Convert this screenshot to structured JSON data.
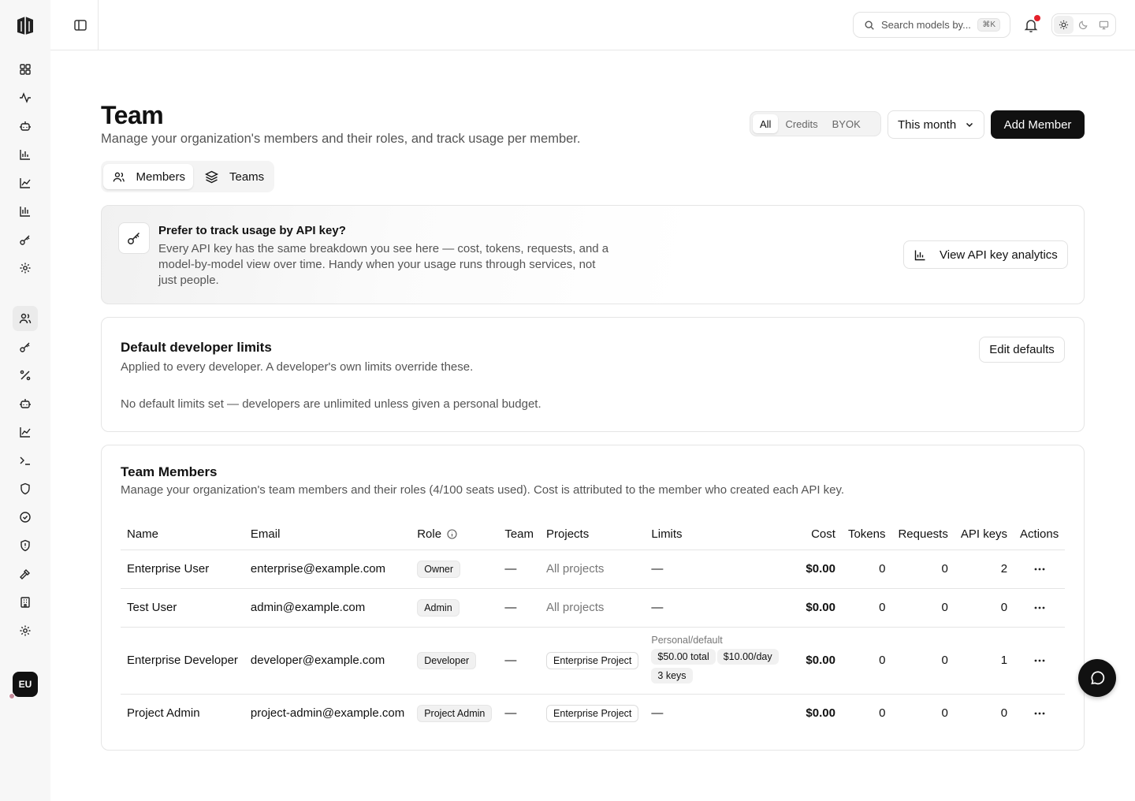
{
  "app": {
    "user_initials": "EU"
  },
  "sidebar": {
    "icons": [
      "dashboard-icon",
      "activity-icon",
      "bot-icon",
      "bar-chart-icon",
      "line-chart-icon",
      "bar-chart-icon",
      "key-icon",
      "gear-icon",
      "users-icon",
      "key-icon",
      "percent-icon",
      "bot-icon",
      "line-chart-icon",
      "terminal-icon",
      "shield-icon",
      "badge-check-icon",
      "shield-alert-icon",
      "hammer-icon",
      "building-icon",
      "gear-icon"
    ],
    "active": "users-icon"
  },
  "topbar": {
    "search_placeholder": "Search models by...",
    "search_shortcut": "⌘K"
  },
  "page": {
    "title": "Team",
    "subtitle": "Manage your organization's members and their roles, and track usage per member.",
    "filters": [
      "All",
      "Credits",
      "BYOK"
    ],
    "active_filter": "All",
    "period": "This month",
    "add_button": "Add Member",
    "tabs": [
      {
        "label": "Members",
        "icon": "users-icon"
      },
      {
        "label": "Teams",
        "icon": "layers-icon"
      }
    ],
    "active_tab": "Members"
  },
  "promo": {
    "title": "Prefer to track usage by API key?",
    "description": "Every API key has the same breakdown you see here — cost, tokens, requests, and a model-by-model view over time. Handy when your usage runs through services, not just people.",
    "button": "View API key analytics"
  },
  "limits": {
    "title": "Default developer limits",
    "description": "Applied to every developer. A developer's own limits override these.",
    "empty": "No default limits set — developers are unlimited unless given a personal budget.",
    "button": "Edit defaults"
  },
  "members": {
    "title": "Team Members",
    "description": "Manage your organization's team members and their roles (4/100 seats used). Cost is attributed to the member who created each API key.",
    "columns": [
      "Name",
      "Email",
      "Role",
      "Team",
      "Projects",
      "Limits",
      "Cost",
      "Tokens",
      "Requests",
      "API keys",
      "Actions"
    ],
    "rows": [
      {
        "name": "Enterprise User",
        "email": "enterprise@example.com",
        "role": "Owner",
        "team": "—",
        "projects": "All projects",
        "limits": "—",
        "cost": "$0.00",
        "tokens": "0",
        "requests": "0",
        "api_keys": "2"
      },
      {
        "name": "Test User",
        "email": "admin@example.com",
        "role": "Admin",
        "team": "—",
        "projects": "All projects",
        "limits": "—",
        "cost": "$0.00",
        "tokens": "0",
        "requests": "0",
        "api_keys": "0"
      },
      {
        "name": "Enterprise Developer",
        "email": "developer@example.com",
        "role": "Developer",
        "team": "—",
        "projects": "Enterprise Project",
        "limits_label": "Personal/default",
        "limits_chips": [
          "$50.00 total",
          "$10.00/day",
          "3 keys"
        ],
        "cost": "$0.00",
        "tokens": "0",
        "requests": "0",
        "api_keys": "1"
      },
      {
        "name": "Project Admin",
        "email": "project-admin@example.com",
        "role": "Project Admin",
        "team": "—",
        "projects": "Enterprise Project",
        "limits": "—",
        "cost": "$0.00",
        "tokens": "0",
        "requests": "0",
        "api_keys": "0"
      }
    ]
  }
}
